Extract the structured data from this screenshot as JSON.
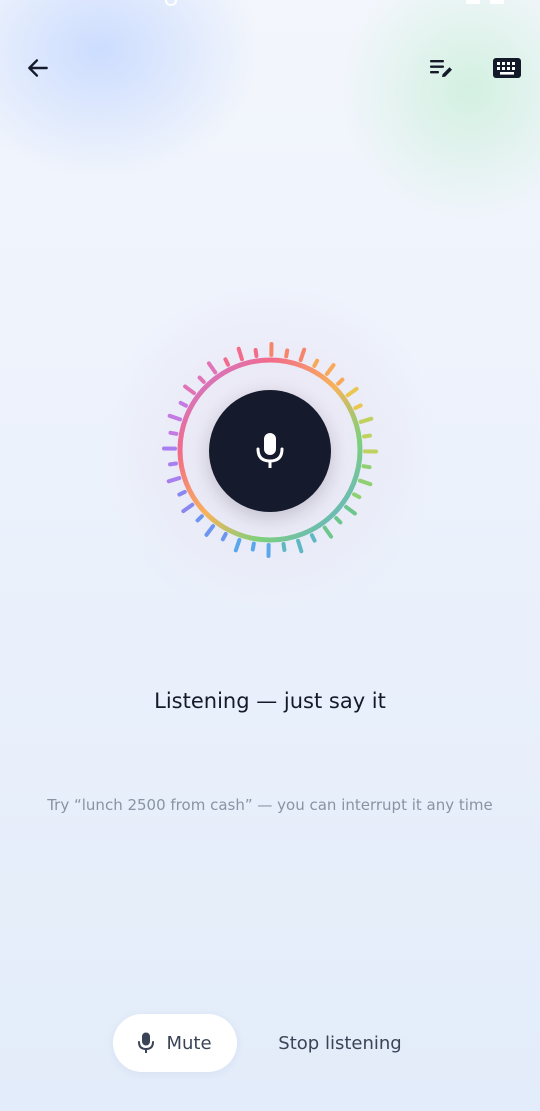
{
  "header": {
    "back_icon": "arrow-left-icon",
    "edit_icon": "edit-list-icon",
    "keyboard_icon": "keyboard-icon"
  },
  "voice": {
    "mic_icon": "microphone-icon",
    "status": "Listening — just say it",
    "hint": "Try “lunch 2500 from cash” — you can interrupt it any time"
  },
  "controls": {
    "mute_label": "Mute",
    "mute_icon": "microphone-icon",
    "stop_label": "Stop listening"
  },
  "colors": {
    "mic_core": "#151a2c",
    "ring_gradient": [
      "#f26b8a",
      "#f8b25a",
      "#7ed07a",
      "#5aa7ec",
      "#a88cf0"
    ]
  }
}
